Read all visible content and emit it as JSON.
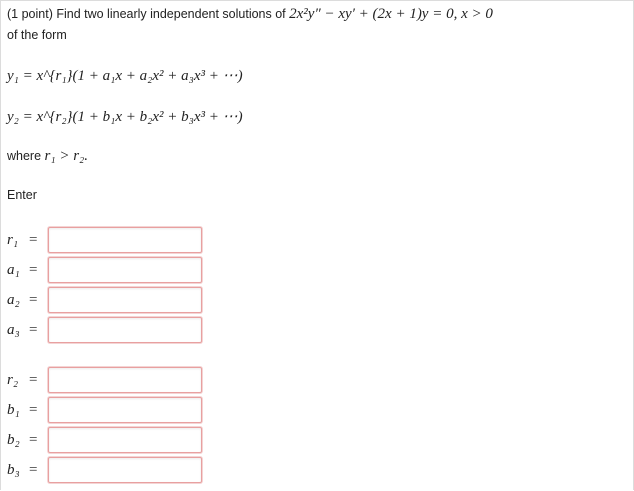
{
  "problem": {
    "points": "(1 point)",
    "prompt_text": "Find two linearly independent solutions of",
    "ode": "2x²y″ − xy′ + (2x + 1)y = 0,  x > 0",
    "of_the_form": "of the form",
    "y1_form": "y₁ = x^{r₁}(1 + a₁x + a₂x² + a₃x³ + ⋯)",
    "y2_form": "y₂ = x^{r₂}(1 + b₁x + b₂x² + b₃x³ + ⋯)",
    "where_text": "where",
    "where_condition": "r₁ > r₂.",
    "enter_label": "Enter"
  },
  "fields": [
    {
      "label": "r₁",
      "value": ""
    },
    {
      "label": "a₁",
      "value": ""
    },
    {
      "label": "a₂",
      "value": ""
    },
    {
      "label": "a₃",
      "value": ""
    },
    {
      "label": "r₂",
      "value": ""
    },
    {
      "label": "b₁",
      "value": ""
    },
    {
      "label": "b₂",
      "value": ""
    },
    {
      "label": "b₃",
      "value": ""
    }
  ],
  "equals_sign": "=",
  "colors": {
    "input_border": "#e8a0a0",
    "text": "#222222"
  }
}
